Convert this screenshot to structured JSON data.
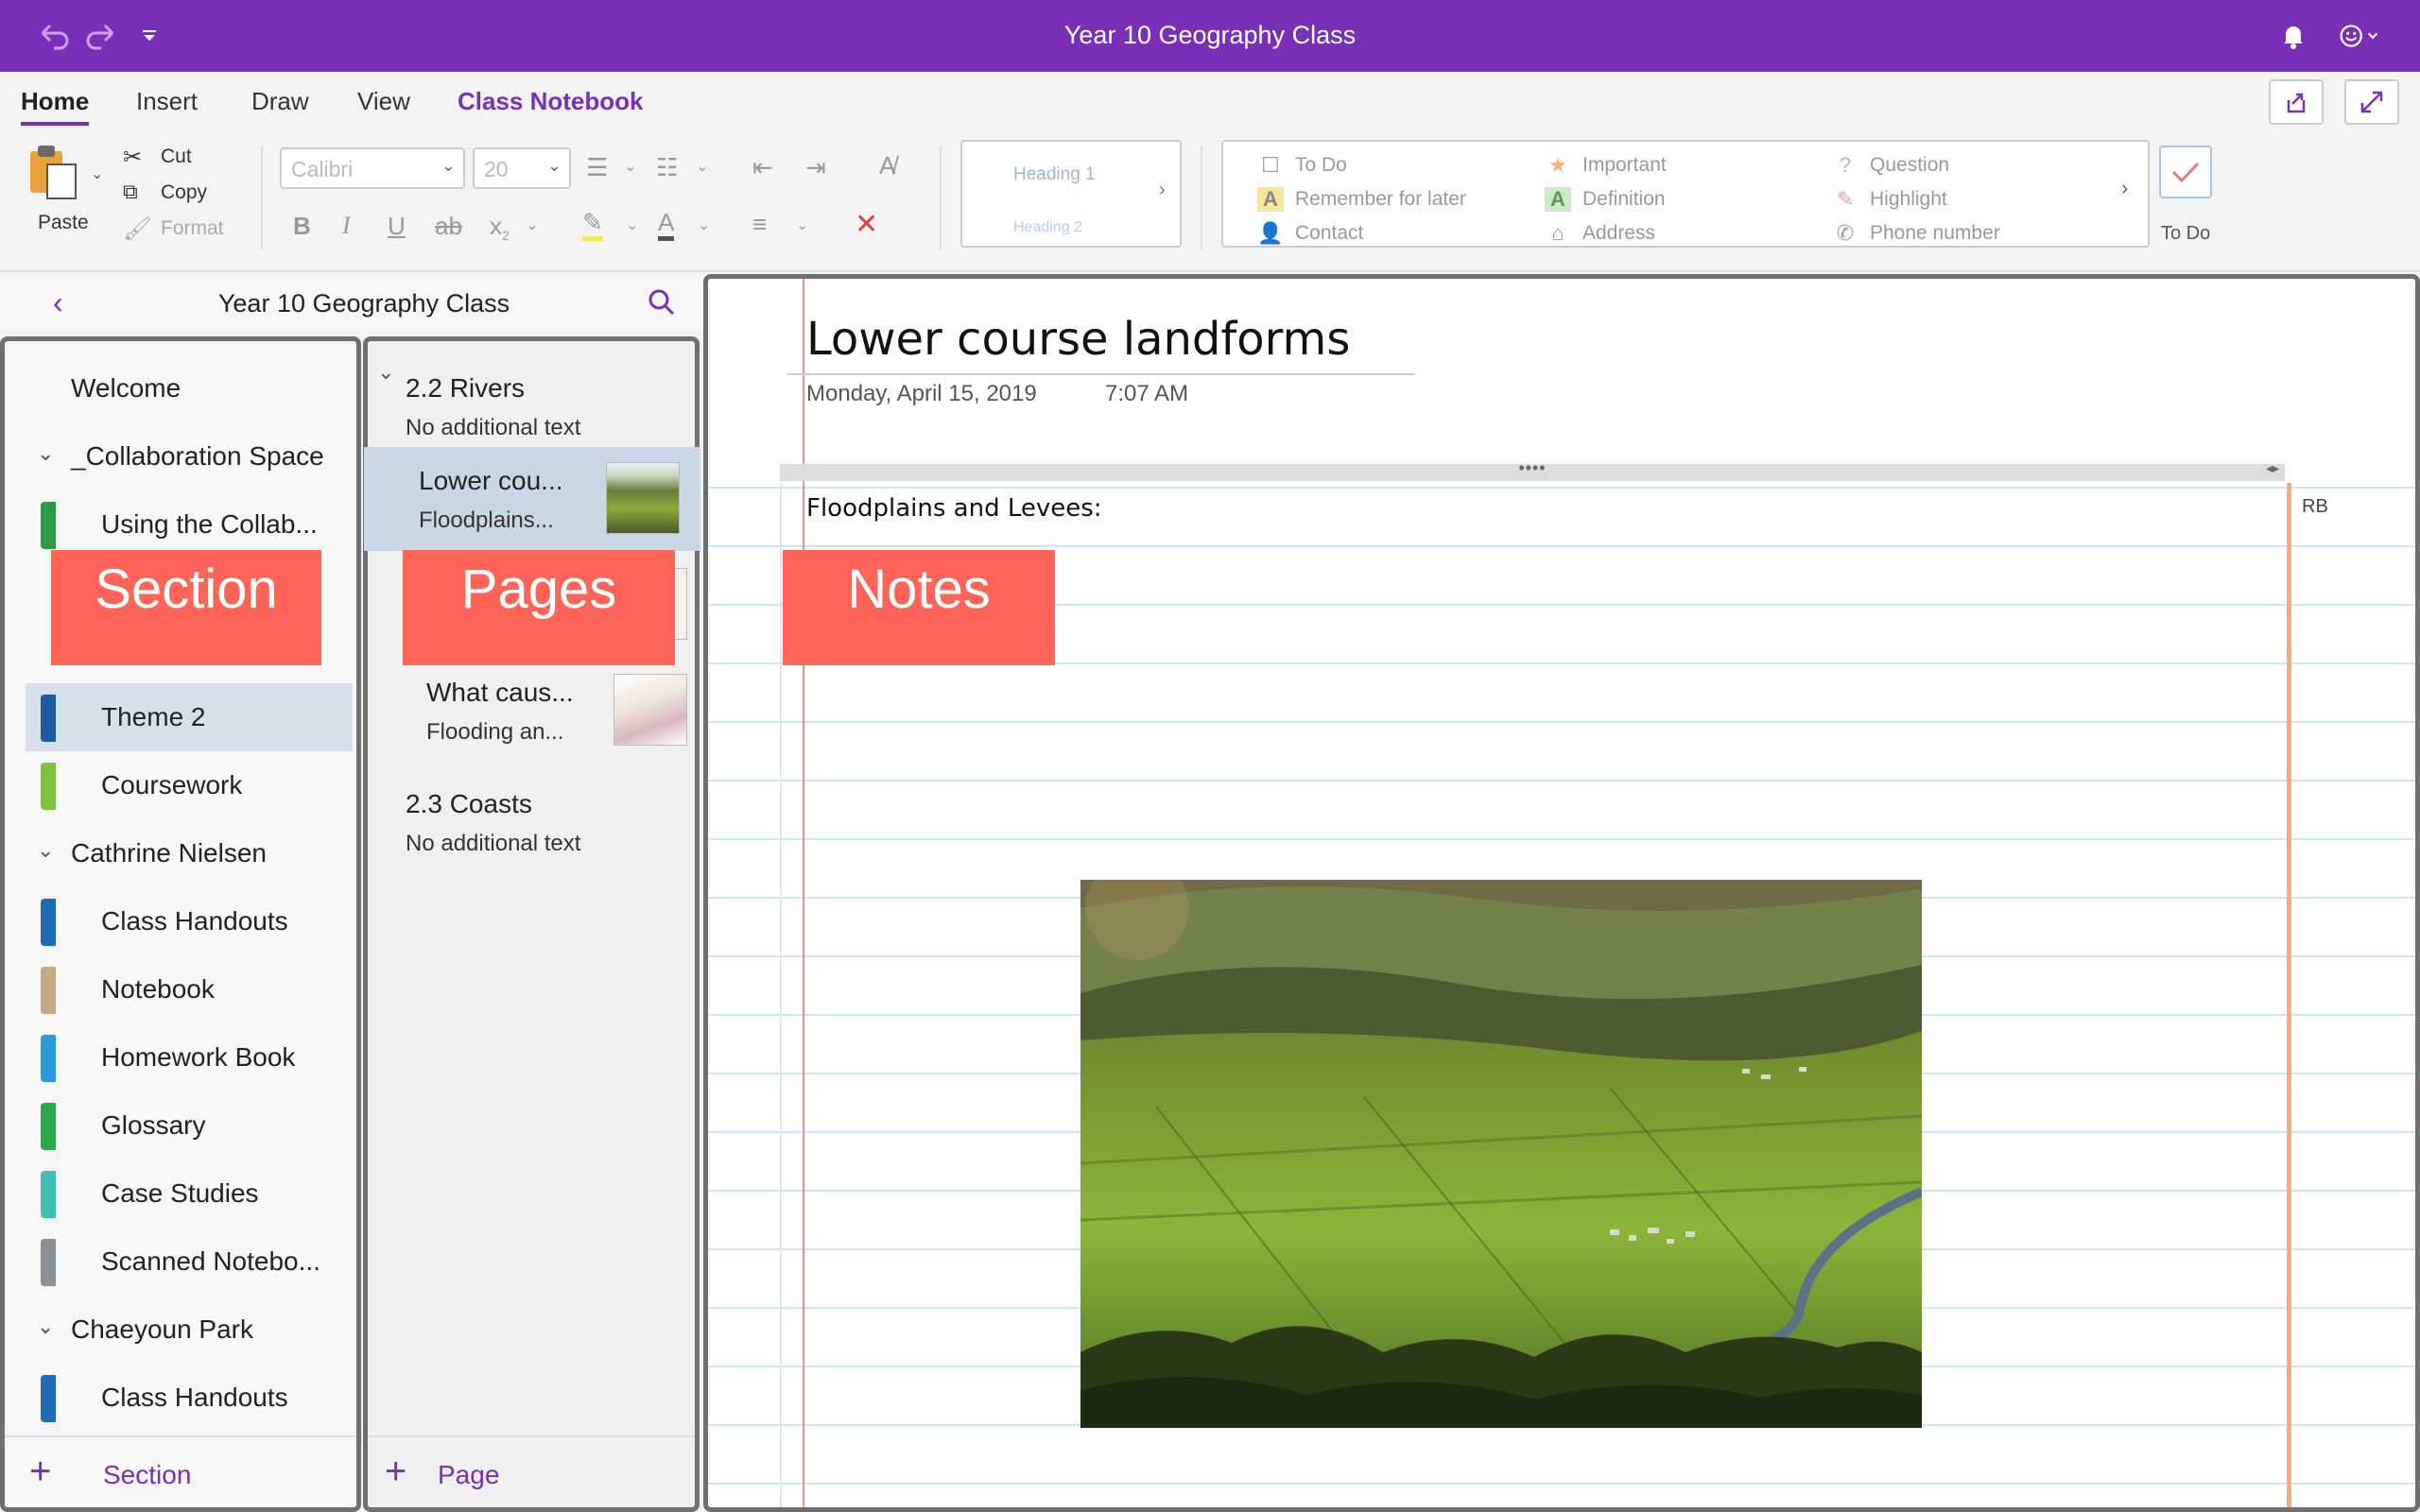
{
  "window": {
    "title": "Year 10 Geography Class"
  },
  "ribbon_tabs": [
    "Home",
    "Insert",
    "Draw",
    "View",
    "Class Notebook"
  ],
  "clipboard": {
    "paste": "Paste",
    "cut": "Cut",
    "copy": "Copy",
    "format": "Format"
  },
  "font": {
    "name": "Calibri",
    "size": "20"
  },
  "styles": {
    "h1": "Heading 1",
    "h2": "Heading 2"
  },
  "tags": {
    "col1": [
      "To Do",
      "Remember for later",
      "Contact"
    ],
    "col2": [
      "Important",
      "Definition",
      "Address"
    ],
    "col3": [
      "Question",
      "Highlight",
      "Phone number"
    ],
    "todo_button": "To Do"
  },
  "nav": {
    "notebook_title": "Year 10 Geography Class",
    "sections": {
      "welcome": "Welcome",
      "collab_group": "_Collaboration Space",
      "using_collab": "Using the Collab...",
      "theme2": "Theme 2",
      "coursework": "Coursework",
      "student1": "Cathrine Nielsen",
      "s1_items": [
        "Class Handouts",
        "Notebook",
        "Homework Book",
        "Glossary",
        "Case Studies",
        "Scanned Notebo..."
      ],
      "student2": "Chaeyoun Park",
      "s2_items": [
        "Class Handouts"
      ],
      "add": "Section"
    },
    "pages": {
      "group1_title": "2.2 Rivers",
      "group1_sub": "No additional text",
      "page1_title": "Lower cou...",
      "page1_sub": "Floodplains...",
      "page2_title": "What caus...",
      "page2_sub": "Flooding an...",
      "group2_title": "2.3 Coasts",
      "group2_sub": "No additional text",
      "add": "Page"
    }
  },
  "annotations": {
    "section": "Section",
    "pages": "Pages",
    "notes": "Notes"
  },
  "note": {
    "title": "Lower course landforms",
    "date": "Monday, April 15, 2019",
    "time": "7:07 AM",
    "text": "Floodplains and Levees:",
    "author_initials": "RB"
  },
  "colors": {
    "accent": "#7a2fb8",
    "annotation": "#ff6459"
  }
}
